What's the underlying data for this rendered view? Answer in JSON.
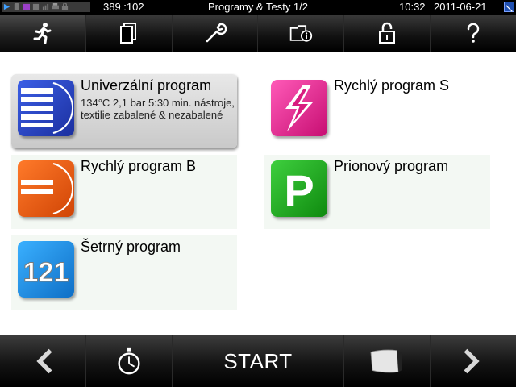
{
  "status": {
    "coords": "389 :102",
    "title": "Programy & Testy 1/2",
    "time": "10:32",
    "date": "2011-06-21",
    "icons": [
      "play-icon",
      "phone-icon",
      "card-icon",
      "memory-icon",
      "chart-icon",
      "printer-icon",
      "lock-icon"
    ]
  },
  "nav": {
    "tabs": [
      {
        "icon": "running-person-icon"
      },
      {
        "icon": "documents-icon"
      },
      {
        "icon": "wrench-icon"
      },
      {
        "icon": "folder-info-icon"
      },
      {
        "icon": "padlock-icon"
      },
      {
        "icon": "help-icon"
      }
    ]
  },
  "programs": [
    {
      "name": "Univerzální program",
      "desc": "134°C 2,1 bar 5:30 min. nástroje, textilie zabalené & nezabalené",
      "icon": "universal-program-icon",
      "color": "#1f3fbf"
    },
    {
      "name": "Rychlý program S",
      "desc": "",
      "icon": "lightning-icon",
      "color": "#e0208a"
    },
    {
      "name": "Rychlý program B",
      "desc": "",
      "icon": "quick-b-icon",
      "color": "#e85a0f"
    },
    {
      "name": "Prionový program",
      "desc": "",
      "icon": "prion-p-icon",
      "color": "#1aa51a"
    },
    {
      "name": "Šetrný program",
      "desc": "",
      "icon": "gentle-121-icon",
      "color": "#1e8ee6",
      "icon_text": "121"
    }
  ],
  "prion_letter": "P",
  "bottom": {
    "start_label": "START",
    "icons": [
      "back-arrow-icon",
      "timer-icon",
      "start",
      "door-icon",
      "forward-arrow-icon"
    ]
  }
}
